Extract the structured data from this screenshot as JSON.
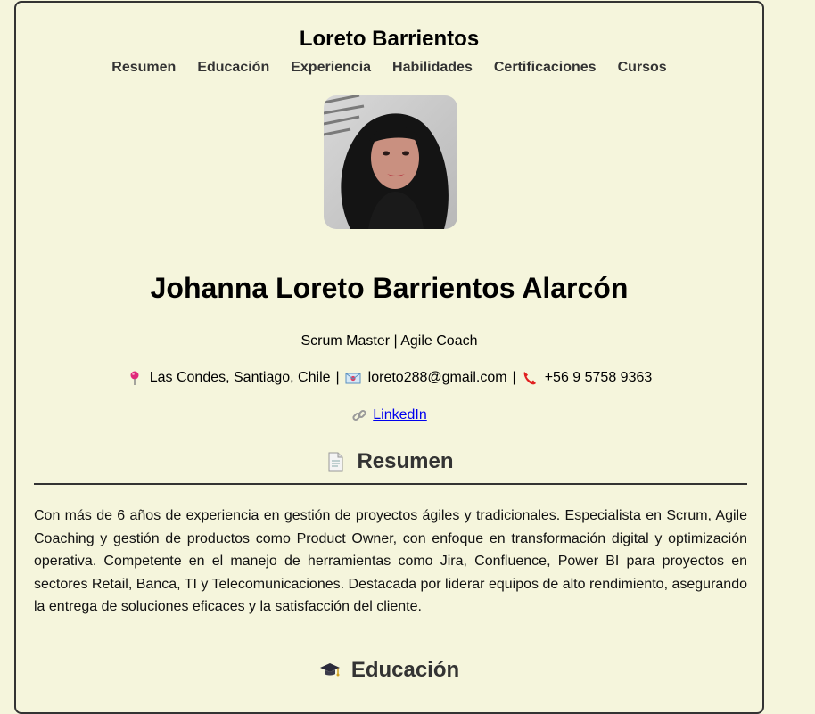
{
  "header": {
    "site_title": "Loreto Barrientos",
    "nav": [
      "Resumen",
      "Educación",
      "Experiencia",
      "Habilidades",
      "Certificaciones",
      "Cursos"
    ]
  },
  "profile": {
    "full_name": "Johanna Loreto Barrientos Alarcón",
    "role": "Scrum Master | Agile Coach",
    "location": "Las Condes, Santiago, Chile",
    "email": "loreto288@gmail.com",
    "phone": "+56 9 5758 9363",
    "separator": "|",
    "linkedin_label": "LinkedIn"
  },
  "sections": {
    "resumen_title": "Resumen",
    "resumen_text": "Con más de 6 años de experiencia en gestión de proyectos ágiles y tradicionales. Especialista en Scrum, Agile Coaching y gestión de productos como Product Owner, con enfoque en transformación digital y optimización operativa. Competente en el manejo de herramientas como Jira, Confluence, Power BI para proyectos en sectores Retail, Banca, TI y Telecomunicaciones. Destacada por liderar equipos de alto rendimiento, asegurando la entrega de soluciones eficaces y la satisfacción del cliente.",
    "educacion_title": "Educación"
  },
  "icons": {
    "location": "pin-icon",
    "email": "envelope-icon",
    "phone": "phone-icon",
    "link": "link-icon",
    "resumen": "document-icon",
    "educacion": "graduation-cap-icon"
  },
  "colors": {
    "background": "#f5f5dc",
    "link": "#0000ee",
    "heading": "#333333"
  }
}
